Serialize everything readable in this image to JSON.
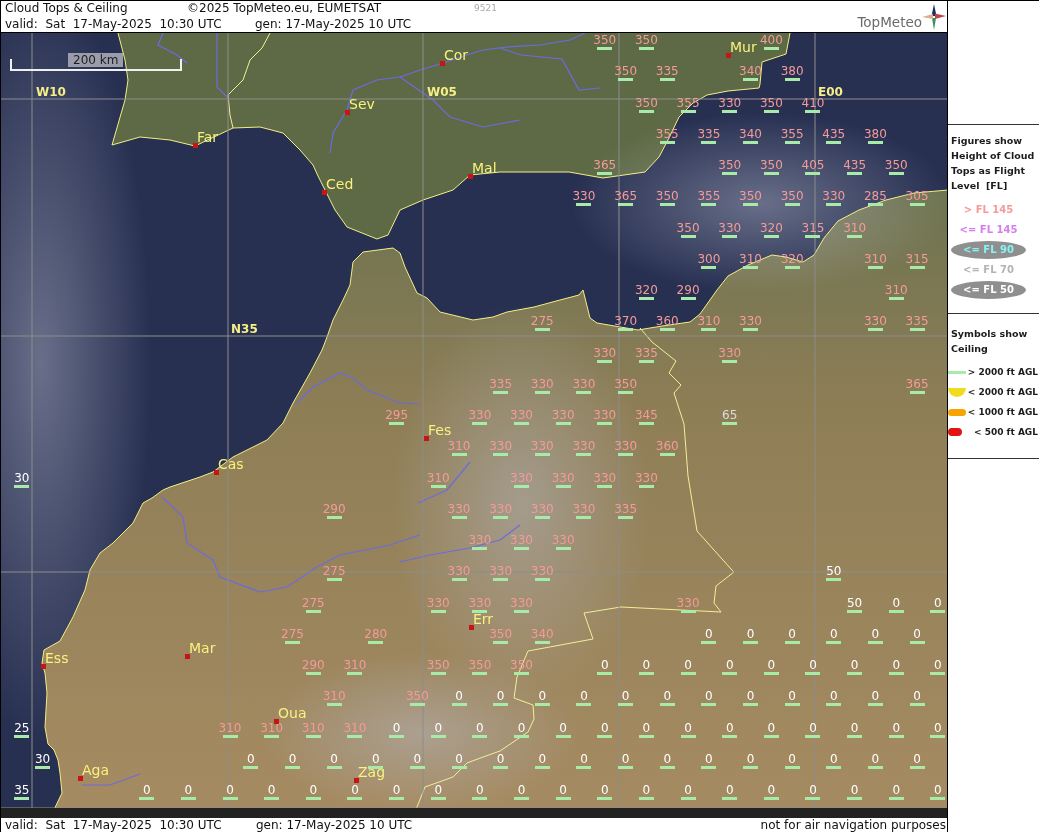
{
  "header": {
    "title": "Cloud Tops & Ceiling",
    "copyright": "©2025 TopMeteo.eu, EUMETSAT",
    "image_number": "9521",
    "valid": "valid:  Sat  17-May-2025  10:30 UTC",
    "generated": "gen: 17-May-2025 10 UTC",
    "logo": "TopMeteo"
  },
  "legend": {
    "tops_heading": "Figures show Height of Cloud Tops as Flight Level  [FL]",
    "tops": [
      {
        "label": "> FL 145",
        "color": "#f59a9a",
        "ellipse": false
      },
      {
        "label": "<= FL 145",
        "color": "#d47fea",
        "ellipse": false
      },
      {
        "label": "<= FL 90",
        "color": "#8af2f2",
        "ellipse": true
      },
      {
        "label": "<= FL 70",
        "color": "#b4b4b4",
        "ellipse": false
      },
      {
        "label": "<= FL 50",
        "color": "#ffffff",
        "ellipse": true
      }
    ],
    "ceiling_heading": "Symbols show Ceiling",
    "ceilings": [
      {
        "label": "> 2000 ft AGL",
        "kind": "over2000"
      },
      {
        "label": "< 2000 ft AGL",
        "kind": "under2000"
      },
      {
        "label": "< 1000 ft AGL",
        "kind": "under1000"
      },
      {
        "label": "< 500 ft AGL",
        "kind": "under500"
      }
    ]
  },
  "map": {
    "scale": "200 km",
    "grid_labels": [
      "W10",
      "W05",
      "E00",
      "N35"
    ],
    "cities": [
      "Mur",
      "Cor",
      "Sev",
      "Far",
      "Mal",
      "Ced",
      "Fes",
      "Cas",
      "Err",
      "Mar",
      "Ess",
      "Oua",
      "Aga",
      "Zag"
    ],
    "value_rows": [
      [
        null,
        null,
        null,
        null,
        null,
        null,
        null,
        null,
        null,
        null,
        null,
        null,
        null,
        null,
        {
          "value": "350",
          "color": "#f59a9a",
          "kind": "over2000"
        },
        {
          "value": "350",
          "color": "#f59a9a",
          "kind": "over2000"
        },
        null,
        null,
        {
          "value": "400",
          "color": "#f59a9a",
          "kind": "over2000"
        }
      ],
      [
        null,
        null,
        null,
        null,
        null,
        null,
        null,
        null,
        null,
        null,
        null,
        null,
        null,
        null,
        {
          "value": "350",
          "color": "#f59a9a",
          "kind": "over2000"
        },
        {
          "value": "335",
          "color": "#f59a9a",
          "kind": "over2000"
        },
        null,
        {
          "value": "340",
          "color": "#f59a9a",
          "kind": "over2000"
        },
        {
          "value": "380",
          "color": "#f59a9a",
          "kind": "over2000"
        }
      ],
      [
        null,
        null,
        null,
        null,
        null,
        null,
        null,
        null,
        null,
        null,
        null,
        null,
        null,
        null,
        null,
        {
          "value": "350",
          "color": "#f59a9a",
          "kind": "over2000"
        },
        {
          "value": "355",
          "color": "#f59a9a",
          "kind": "over2000"
        },
        {
          "value": "330",
          "color": "#f59a9a",
          "kind": "over2000"
        },
        {
          "value": "350",
          "color": "#f59a9a",
          "kind": "over2000"
        },
        {
          "value": "410",
          "color": "#f59a9a",
          "kind": "over2000"
        }
      ],
      [
        null,
        null,
        null,
        null,
        null,
        null,
        null,
        null,
        null,
        null,
        null,
        null,
        null,
        null,
        null,
        {
          "value": "355",
          "color": "#f59a9a",
          "kind": "over2000"
        },
        {
          "value": "335",
          "color": "#f59a9a",
          "kind": "over2000"
        },
        {
          "value": "340",
          "color": "#f59a9a",
          "kind": "over2000"
        },
        {
          "value": "355",
          "color": "#f59a9a",
          "kind": "over2000"
        },
        {
          "value": "435",
          "color": "#f59a9a",
          "kind": "over2000"
        },
        {
          "value": "380",
          "color": "#f59a9a",
          "kind": "over2000"
        }
      ],
      [
        null,
        null,
        null,
        null,
        null,
        null,
        null,
        null,
        null,
        null,
        null,
        null,
        null,
        null,
        {
          "value": "365",
          "color": "#f59a9a",
          "kind": "over2000"
        },
        null,
        null,
        {
          "value": "350",
          "color": "#f59a9a",
          "kind": "over2000"
        },
        {
          "value": "350",
          "color": "#f59a9a",
          "kind": "over2000"
        },
        {
          "value": "405",
          "color": "#f59a9a",
          "kind": "over2000"
        },
        {
          "value": "435",
          "color": "#f59a9a",
          "kind": "over2000"
        },
        {
          "value": "350",
          "color": "#f59a9a",
          "kind": "over2000"
        }
      ],
      [
        null,
        null,
        null,
        null,
        null,
        null,
        null,
        null,
        null,
        null,
        null,
        null,
        null,
        {
          "value": "330",
          "color": "#f59a9a",
          "kind": "over2000"
        },
        {
          "value": "365",
          "color": "#f59a9a",
          "kind": "over2000"
        },
        {
          "value": "350",
          "color": "#f59a9a",
          "kind": "over2000"
        },
        {
          "value": "355",
          "color": "#f59a9a",
          "kind": "over2000"
        },
        {
          "value": "350",
          "color": "#f59a9a",
          "kind": "over2000"
        },
        {
          "value": "350",
          "color": "#f59a9a",
          "kind": "over2000"
        },
        {
          "value": "330",
          "color": "#f59a9a",
          "kind": "over2000"
        },
        {
          "value": "285",
          "color": "#f59a9a",
          "kind": "over2000"
        },
        {
          "value": "305",
          "color": "#f59a9a",
          "kind": "over2000"
        }
      ],
      [
        null,
        null,
        null,
        null,
        null,
        null,
        null,
        null,
        null,
        null,
        null,
        null,
        null,
        null,
        null,
        null,
        {
          "value": "350",
          "color": "#f59a9a",
          "kind": "over2000"
        },
        {
          "value": "330",
          "color": "#f59a9a",
          "kind": "over2000"
        },
        {
          "value": "320",
          "color": "#f59a9a",
          "kind": "over2000"
        },
        {
          "value": "315",
          "color": "#f59a9a",
          "kind": "over2000"
        },
        {
          "value": "310",
          "color": "#f59a9a",
          "kind": "over2000"
        }
      ],
      [
        null,
        null,
        null,
        null,
        null,
        null,
        null,
        null,
        null,
        null,
        null,
        null,
        null,
        null,
        null,
        null,
        {
          "value": "300",
          "color": "#f59a9a",
          "kind": "over2000"
        },
        {
          "value": "310",
          "color": "#f59a9a",
          "kind": "over2000"
        },
        {
          "value": "320",
          "color": "#f59a9a",
          "kind": "over2000"
        },
        null,
        {
          "value": "310",
          "color": "#f59a9a",
          "kind": "over2000"
        },
        {
          "value": "315",
          "color": "#f59a9a",
          "kind": "over2000"
        }
      ],
      [
        null,
        null,
        null,
        null,
        null,
        null,
        null,
        null,
        null,
        null,
        null,
        null,
        null,
        null,
        null,
        {
          "value": "320",
          "color": "#f59a9a",
          "kind": "over2000"
        },
        {
          "value": "290",
          "color": "#f59a9a",
          "kind": "over2000"
        },
        null,
        null,
        null,
        null,
        {
          "value": "310",
          "color": "#f59a9a",
          "kind": "over2000"
        }
      ],
      [
        null,
        null,
        null,
        null,
        null,
        null,
        null,
        null,
        null,
        null,
        null,
        null,
        {
          "value": "275",
          "color": "#f59a9a",
          "kind": "over2000"
        },
        null,
        {
          "value": "370",
          "color": "#f59a9a",
          "kind": "over2000"
        },
        {
          "value": "360",
          "color": "#f59a9a",
          "kind": "over2000"
        },
        {
          "value": "310",
          "color": "#f59a9a",
          "kind": "over2000"
        },
        {
          "value": "330",
          "color": "#f59a9a",
          "kind": "over2000"
        },
        null,
        null,
        {
          "value": "330",
          "color": "#f59a9a",
          "kind": "over2000"
        },
        {
          "value": "335",
          "color": "#f59a9a",
          "kind": "over2000"
        }
      ],
      [
        null,
        null,
        null,
        null,
        null,
        null,
        null,
        null,
        null,
        null,
        null,
        null,
        null,
        null,
        {
          "value": "330",
          "color": "#f59a9a",
          "kind": "over2000"
        },
        {
          "value": "335",
          "color": "#f59a9a",
          "kind": "over2000"
        },
        null,
        {
          "value": "330",
          "color": "#f59a9a",
          "kind": "over2000"
        }
      ],
      [
        null,
        null,
        null,
        null,
        null,
        null,
        null,
        null,
        null,
        null,
        null,
        {
          "value": "335",
          "color": "#f59a9a",
          "kind": "over2000"
        },
        {
          "value": "330",
          "color": "#f59a9a",
          "kind": "over2000"
        },
        {
          "value": "330",
          "color": "#f59a9a",
          "kind": "over2000"
        },
        {
          "value": "350",
          "color": "#f59a9a",
          "kind": "over2000"
        },
        null,
        null,
        null,
        null,
        null,
        null,
        {
          "value": "365",
          "color": "#f59a9a",
          "kind": "over2000"
        }
      ],
      [
        null,
        null,
        null,
        null,
        null,
        null,
        null,
        null,
        null,
        {
          "value": "295",
          "color": "#f59a9a",
          "kind": "over2000"
        },
        null,
        {
          "value": "330",
          "color": "#f59a9a",
          "kind": "over2000"
        },
        {
          "value": "330",
          "color": "#f59a9a",
          "kind": "over2000"
        },
        {
          "value": "330",
          "color": "#f59a9a",
          "kind": "over2000"
        },
        {
          "value": "330",
          "color": "#f59a9a",
          "kind": "over2000"
        },
        {
          "value": "345",
          "color": "#f59a9a",
          "kind": "over2000"
        },
        null,
        {
          "value": "65",
          "color": "#dcdcdc",
          "kind": "over2000"
        }
      ],
      [
        null,
        null,
        null,
        null,
        null,
        null,
        null,
        null,
        null,
        null,
        {
          "value": "310",
          "color": "#f59a9a",
          "kind": "over2000"
        },
        {
          "value": "330",
          "color": "#f59a9a",
          "kind": "over2000"
        },
        {
          "value": "330",
          "color": "#f59a9a",
          "kind": "over2000"
        },
        {
          "value": "330",
          "color": "#f59a9a",
          "kind": "over2000"
        },
        {
          "value": "330",
          "color": "#f59a9a",
          "kind": "over2000"
        },
        {
          "value": "360",
          "color": "#f59a9a",
          "kind": "over2000"
        }
      ],
      [
        {
          "value": "30",
          "color": "#ffffff",
          "kind": "over2000"
        },
        null,
        null,
        null,
        null,
        null,
        null,
        null,
        null,
        null,
        {
          "value": "310",
          "color": "#f59a9a",
          "kind": "over2000"
        },
        null,
        {
          "value": "330",
          "color": "#f59a9a",
          "kind": "over2000"
        },
        {
          "value": "330",
          "color": "#f59a9a",
          "kind": "over2000"
        },
        {
          "value": "330",
          "color": "#f59a9a",
          "kind": "over2000"
        },
        {
          "value": "330",
          "color": "#f59a9a",
          "kind": "over2000"
        }
      ],
      [
        null,
        null,
        null,
        null,
        null,
        null,
        null,
        {
          "value": "290",
          "color": "#f59a9a",
          "kind": "over2000"
        },
        null,
        null,
        {
          "value": "330",
          "color": "#f59a9a",
          "kind": "over2000"
        },
        {
          "value": "330",
          "color": "#f59a9a",
          "kind": "over2000"
        },
        {
          "value": "330",
          "color": "#f59a9a",
          "kind": "over2000"
        },
        {
          "value": "330",
          "color": "#f59a9a",
          "kind": "over2000"
        },
        {
          "value": "335",
          "color": "#f59a9a",
          "kind": "over2000"
        }
      ],
      [
        null,
        null,
        null,
        null,
        null,
        null,
        null,
        null,
        null,
        null,
        null,
        {
          "value": "330",
          "color": "#f59a9a",
          "kind": "over2000"
        },
        {
          "value": "330",
          "color": "#f59a9a",
          "kind": "over2000"
        },
        {
          "value": "330",
          "color": "#f59a9a",
          "kind": "over2000"
        }
      ],
      [
        null,
        null,
        null,
        null,
        null,
        null,
        null,
        {
          "value": "275",
          "color": "#f59a9a",
          "kind": "over2000"
        },
        null,
        null,
        {
          "value": "330",
          "color": "#f59a9a",
          "kind": "over2000"
        },
        {
          "value": "330",
          "color": "#f59a9a",
          "kind": "over2000"
        },
        {
          "value": "330",
          "color": "#f59a9a",
          "kind": "over2000"
        },
        null,
        null,
        null,
        null,
        null,
        null,
        {
          "value": "50",
          "color": "#ffffff",
          "kind": "over2000"
        }
      ],
      [
        null,
        null,
        null,
        null,
        null,
        null,
        null,
        {
          "value": "275",
          "color": "#f59a9a",
          "kind": "over2000"
        },
        null,
        null,
        {
          "value": "330",
          "color": "#f59a9a",
          "kind": "over2000"
        },
        {
          "value": "330",
          "color": "#f59a9a",
          "kind": "over2000"
        },
        {
          "value": "330",
          "color": "#f59a9a",
          "kind": "over2000"
        },
        null,
        null,
        null,
        {
          "value": "330",
          "color": "#f59a9a",
          "kind": "over2000"
        },
        null,
        null,
        null,
        {
          "value": "50",
          "color": "#ffffff",
          "kind": "over2000"
        },
        {
          "value": "0",
          "color": "#ffffff",
          "kind": "over2000"
        },
        {
          "value": "0",
          "color": "#ffffff",
          "kind": "over2000"
        }
      ],
      [
        null,
        null,
        null,
        null,
        null,
        null,
        {
          "value": "275",
          "color": "#f59a9a",
          "kind": "over2000"
        },
        null,
        {
          "value": "280",
          "color": "#f59a9a",
          "kind": "over2000"
        },
        null,
        null,
        {
          "value": "350",
          "color": "#f59a9a",
          "kind": "over2000"
        },
        {
          "value": "340",
          "color": "#f59a9a",
          "kind": "over2000"
        },
        null,
        null,
        null,
        {
          "value": "0",
          "color": "#ffffff",
          "kind": "over2000"
        },
        {
          "value": "0",
          "color": "#ffffff",
          "kind": "over2000"
        },
        {
          "value": "0",
          "color": "#ffffff",
          "kind": "over2000"
        },
        {
          "value": "0",
          "color": "#ffffff",
          "kind": "over2000"
        },
        {
          "value": "0",
          "color": "#ffffff",
          "kind": "over2000"
        },
        {
          "value": "0",
          "color": "#ffffff",
          "kind": "over2000"
        }
      ],
      [
        null,
        null,
        null,
        null,
        null,
        null,
        null,
        {
          "value": "290",
          "color": "#f59a9a",
          "kind": "over2000"
        },
        {
          "value": "310",
          "color": "#f59a9a",
          "kind": "over2000"
        },
        null,
        {
          "value": "350",
          "color": "#f59a9a",
          "kind": "over2000"
        },
        {
          "value": "350",
          "color": "#f59a9a",
          "kind": "over2000"
        },
        {
          "value": "350",
          "color": "#f59a9a",
          "kind": "over2000"
        },
        null,
        {
          "value": "0",
          "color": "#ffffff",
          "kind": "over2000"
        },
        {
          "value": "0",
          "color": "#ffffff",
          "kind": "over2000"
        },
        {
          "value": "0",
          "color": "#ffffff",
          "kind": "over2000"
        },
        {
          "value": "0",
          "color": "#ffffff",
          "kind": "over2000"
        },
        {
          "value": "0",
          "color": "#ffffff",
          "kind": "over2000"
        },
        {
          "value": "0",
          "color": "#ffffff",
          "kind": "over2000"
        },
        {
          "value": "0",
          "color": "#ffffff",
          "kind": "over2000"
        },
        {
          "value": "0",
          "color": "#ffffff",
          "kind": "over2000"
        },
        {
          "value": "0",
          "color": "#ffffff",
          "kind": "over2000"
        }
      ],
      [
        null,
        null,
        null,
        null,
        null,
        null,
        null,
        {
          "value": "310",
          "color": "#f59a9a",
          "kind": "over2000"
        },
        null,
        {
          "value": "350",
          "color": "#f59a9a",
          "kind": "over2000"
        },
        {
          "value": "0",
          "color": "#ffffff",
          "kind": "over2000"
        },
        {
          "value": "0",
          "color": "#ffffff",
          "kind": "over2000"
        },
        {
          "value": "0",
          "color": "#ffffff",
          "kind": "over2000"
        },
        {
          "value": "0",
          "color": "#ffffff",
          "kind": "over2000"
        },
        {
          "value": "0",
          "color": "#ffffff",
          "kind": "over2000"
        },
        {
          "value": "0",
          "color": "#ffffff",
          "kind": "over2000"
        },
        {
          "value": "0",
          "color": "#ffffff",
          "kind": "over2000"
        },
        {
          "value": "0",
          "color": "#ffffff",
          "kind": "over2000"
        },
        {
          "value": "0",
          "color": "#ffffff",
          "kind": "over2000"
        },
        {
          "value": "0",
          "color": "#ffffff",
          "kind": "over2000"
        },
        {
          "value": "0",
          "color": "#ffffff",
          "kind": "over2000"
        },
        {
          "value": "0",
          "color": "#ffffff",
          "kind": "over2000"
        }
      ],
      [
        {
          "value": "25",
          "color": "#ffffff",
          "kind": "over2000"
        },
        null,
        null,
        null,
        null,
        {
          "value": "310",
          "color": "#f59a9a",
          "kind": "over2000"
        },
        {
          "value": "310",
          "color": "#f59a9a",
          "kind": "over2000"
        },
        {
          "value": "310",
          "color": "#f59a9a",
          "kind": "over2000"
        },
        {
          "value": "310",
          "color": "#f59a9a",
          "kind": "over2000"
        },
        {
          "value": "0",
          "color": "#ffffff",
          "kind": "over2000"
        },
        {
          "value": "0",
          "color": "#ffffff",
          "kind": "over2000"
        },
        {
          "value": "0",
          "color": "#ffffff",
          "kind": "over2000"
        },
        {
          "value": "0",
          "color": "#ffffff",
          "kind": "over2000"
        },
        {
          "value": "0",
          "color": "#ffffff",
          "kind": "over2000"
        },
        {
          "value": "0",
          "color": "#ffffff",
          "kind": "over2000"
        },
        {
          "value": "0",
          "color": "#ffffff",
          "kind": "over2000"
        },
        {
          "value": "0",
          "color": "#ffffff",
          "kind": "over2000"
        },
        {
          "value": "0",
          "color": "#ffffff",
          "kind": "over2000"
        },
        {
          "value": "0",
          "color": "#ffffff",
          "kind": "over2000"
        },
        {
          "value": "0",
          "color": "#ffffff",
          "kind": "over2000"
        },
        {
          "value": "0",
          "color": "#ffffff",
          "kind": "over2000"
        },
        {
          "value": "0",
          "color": "#ffffff",
          "kind": "over2000"
        },
        {
          "value": "0",
          "color": "#ffffff",
          "kind": "over2000"
        }
      ],
      [
        {
          "value": "30",
          "color": "#ffffff",
          "kind": "over2000"
        },
        null,
        null,
        null,
        null,
        {
          "value": "0",
          "color": "#ffffff",
          "kind": "over2000"
        },
        {
          "value": "0",
          "color": "#ffffff",
          "kind": "over2000"
        },
        {
          "value": "0",
          "color": "#ffffff",
          "kind": "over2000"
        },
        {
          "value": "0",
          "color": "#ffffff",
          "kind": "over2000"
        },
        {
          "value": "0",
          "color": "#ffffff",
          "kind": "over2000"
        },
        {
          "value": "0",
          "color": "#ffffff",
          "kind": "over2000"
        },
        {
          "value": "0",
          "color": "#ffffff",
          "kind": "over2000"
        },
        {
          "value": "0",
          "color": "#ffffff",
          "kind": "over2000"
        },
        {
          "value": "0",
          "color": "#ffffff",
          "kind": "over2000"
        },
        {
          "value": "0",
          "color": "#ffffff",
          "kind": "over2000"
        },
        {
          "value": "0",
          "color": "#ffffff",
          "kind": "over2000"
        },
        {
          "value": "0",
          "color": "#ffffff",
          "kind": "over2000"
        },
        {
          "value": "0",
          "color": "#ffffff",
          "kind": "over2000"
        },
        {
          "value": "0",
          "color": "#ffffff",
          "kind": "over2000"
        },
        {
          "value": "0",
          "color": "#ffffff",
          "kind": "over2000"
        },
        {
          "value": "0",
          "color": "#ffffff",
          "kind": "over2000"
        },
        {
          "value": "0",
          "color": "#ffffff",
          "kind": "over2000"
        }
      ],
      [
        {
          "value": "35",
          "color": "#ffffff",
          "kind": "over2000"
        },
        null,
        null,
        {
          "value": "0",
          "color": "#ffffff",
          "kind": "over2000"
        },
        {
          "value": "0",
          "color": "#ffffff",
          "kind": "over2000"
        },
        {
          "value": "0",
          "color": "#ffffff",
          "kind": "over2000"
        },
        {
          "value": "0",
          "color": "#ffffff",
          "kind": "over2000"
        },
        {
          "value": "0",
          "color": "#ffffff",
          "kind": "over2000"
        },
        {
          "value": "0",
          "color": "#ffffff",
          "kind": "over2000"
        },
        {
          "value": "0",
          "color": "#ffffff",
          "kind": "over2000"
        },
        {
          "value": "0",
          "color": "#ffffff",
          "kind": "over2000"
        },
        {
          "value": "0",
          "color": "#ffffff",
          "kind": "over2000"
        },
        {
          "value": "0",
          "color": "#ffffff",
          "kind": "over2000"
        },
        {
          "value": "0",
          "color": "#ffffff",
          "kind": "over2000"
        },
        {
          "value": "0",
          "color": "#ffffff",
          "kind": "over2000"
        },
        {
          "value": "0",
          "color": "#ffffff",
          "kind": "over2000"
        },
        {
          "value": "0",
          "color": "#ffffff",
          "kind": "over2000"
        },
        {
          "value": "0",
          "color": "#ffffff",
          "kind": "over2000"
        },
        {
          "value": "0",
          "color": "#ffffff",
          "kind": "over2000"
        },
        {
          "value": "0",
          "color": "#ffffff",
          "kind": "over2000"
        },
        {
          "value": "0",
          "color": "#ffffff",
          "kind": "over2000"
        },
        {
          "value": "0",
          "color": "#ffffff",
          "kind": "over2000"
        },
        {
          "value": "0",
          "color": "#ffffff",
          "kind": "over2000"
        }
      ]
    ]
  },
  "footer": {
    "valid": "valid:  Sat  17-May-2025  10:30 UTC",
    "generated": "gen: 17-May-2025 10 UTC",
    "disclaimer": "not for air navigation purposes"
  }
}
